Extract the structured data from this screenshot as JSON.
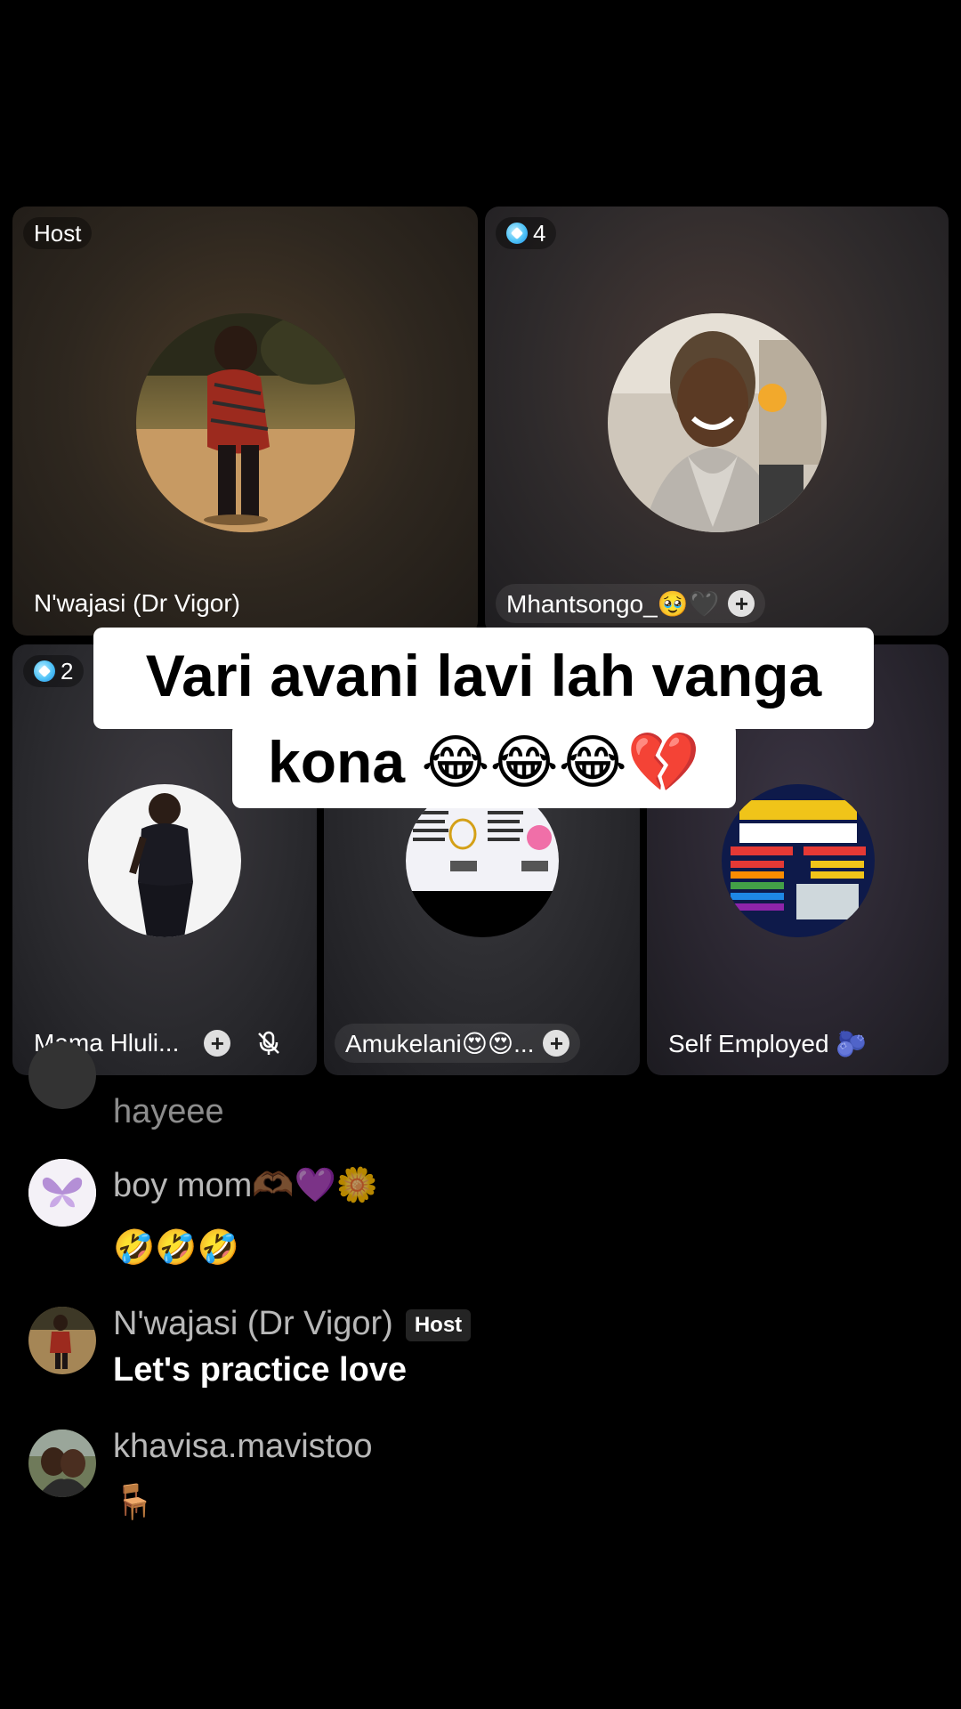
{
  "grid": {
    "host_tile": {
      "badge": "Host",
      "name": "N'wajasi (Dr Vigor)"
    },
    "tile_2": {
      "badge_count": "4",
      "name": "Mhantsongo_🥹🖤"
    },
    "tile_3": {
      "badge_count": "2",
      "name": "Mama Hluli..."
    },
    "tile_4": {
      "name": "Amukelani😍😍..."
    },
    "tile_5": {
      "name": "Self Employed 🫐"
    }
  },
  "caption": {
    "line1": "Vari avani lavi lah vanga",
    "line2": "kona 😂😂😂💔"
  },
  "chat": {
    "partial": {
      "text": "hayeee"
    },
    "messages": [
      {
        "user": "boy mom🫶🏾💜🌼",
        "text": "🤣🤣🤣",
        "host_tag": ""
      },
      {
        "user": "N'wajasi (Dr Vigor)",
        "text": "Let's practice love",
        "host_tag": "Host"
      },
      {
        "user": "khavisa.mavistoo",
        "text": "🪑",
        "host_tag": ""
      }
    ]
  },
  "colors": {
    "background": "#000000",
    "badge_gem": "#4fc3f7",
    "caption_bg": "#ffffff"
  }
}
